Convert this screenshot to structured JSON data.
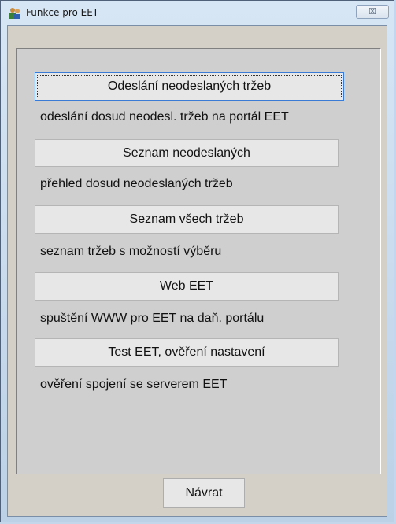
{
  "window": {
    "title": "Funkce pro EET",
    "close_glyph": "☒"
  },
  "functions": [
    {
      "button_label": "Odeslání neodeslaných tržeb",
      "description": "odeslání dosud neodesl. tržeb na portál EET",
      "focused": true
    },
    {
      "button_label": "Seznam neodeslaných",
      "description": "přehled dosud neodeslaných tržeb"
    },
    {
      "button_label": "Seznam všech tržeb",
      "description": "seznam tržeb s možností výběru"
    },
    {
      "button_label": "Web EET",
      "description": "spuštění WWW pro EET na daň. portálu"
    },
    {
      "button_label": "Test EET, ověření nastavení",
      "description": "ověření spojení se serverem EET"
    }
  ],
  "footer": {
    "return_label": "Návrat"
  },
  "icons": {
    "app": "people-icon",
    "close": "close-icon"
  }
}
